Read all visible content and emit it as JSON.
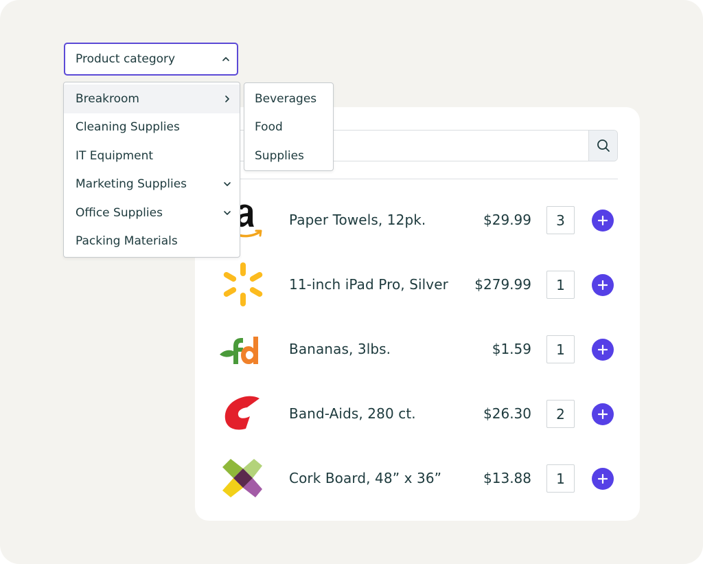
{
  "dropdown": {
    "label": "Product category",
    "items": [
      {
        "label": "Breakroom"
      },
      {
        "label": "Cleaning Supplies"
      },
      {
        "label": "IT Equipment"
      },
      {
        "label": "Marketing Supplies"
      },
      {
        "label": "Office Supplies"
      },
      {
        "label": "Packing Materials"
      }
    ],
    "submenu": [
      "Beverages",
      "Food",
      "Supplies"
    ]
  },
  "search": {
    "icon": "search-icon"
  },
  "products": [
    {
      "name": "Paper Towels, 12pk.",
      "price": "$29.99",
      "qty": "3",
      "logo": "amazon-logo"
    },
    {
      "name": "11-inch iPad Pro, Silver",
      "price": "$279.99",
      "qty": "1",
      "logo": "walmart-logo"
    },
    {
      "name": "Bananas, 3lbs.",
      "price": "$1.59",
      "qty": "1",
      "logo": "freshdirect-logo"
    },
    {
      "name": "Band-Aids, 280 ct.",
      "price": "$26.30",
      "qty": "2",
      "logo": "cvs-logo"
    },
    {
      "name": "Cork Board, 48” x 36”",
      "price": "$13.88",
      "qty": "1",
      "logo": "office-logo"
    }
  ],
  "colors": {
    "accent": "#5540e6",
    "text": "#1d3a3d",
    "background": "#f4f3ef"
  }
}
